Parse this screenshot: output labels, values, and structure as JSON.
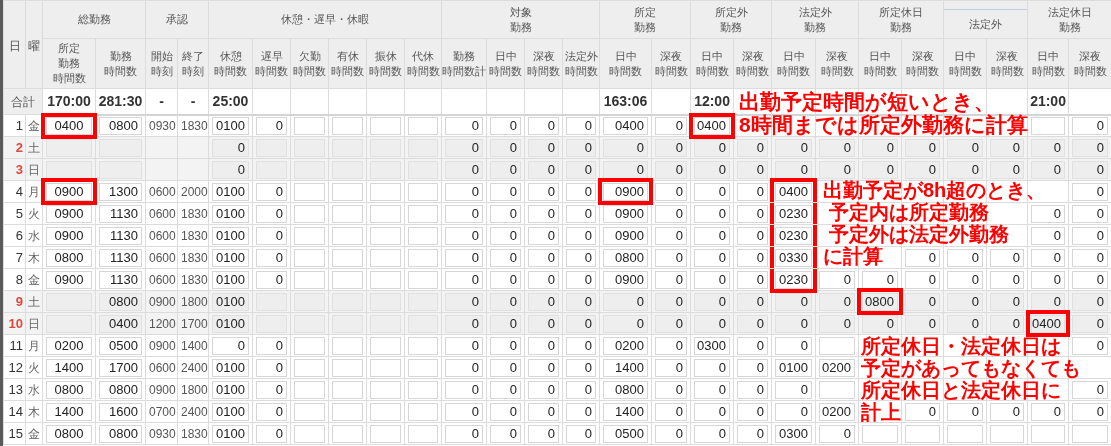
{
  "groups": [
    {
      "label": [
        "総勤務"
      ],
      "kind": "main",
      "columns": [
        {
          "label": [
            "所定",
            "勤務",
            "時間数"
          ],
          "kind": "field"
        },
        {
          "label": [
            "勤務",
            "時間数"
          ],
          "kind": "field"
        }
      ]
    },
    {
      "label": [
        "承認"
      ],
      "kind": "main",
      "columns": [
        {
          "label": [
            "開始",
            "時刻"
          ],
          "kind": "text"
        },
        {
          "label": [
            "終了",
            "時刻"
          ],
          "kind": "text"
        }
      ]
    },
    {
      "label": [
        "休憩・遅早・休暇"
      ],
      "kind": "main",
      "columns": [
        {
          "label": [
            "休憩",
            "時間数"
          ],
          "kind": "field"
        },
        {
          "label": [
            "遅早",
            "時間数"
          ],
          "kind": "field"
        },
        {
          "label": [
            "欠勤",
            "時間数"
          ],
          "kind": "field"
        },
        {
          "label": [
            "有休",
            "時間数"
          ],
          "kind": "field"
        },
        {
          "label": [
            "振休",
            "時間数"
          ],
          "kind": "field"
        },
        {
          "label": [
            "代休",
            "時間数"
          ],
          "kind": "field"
        }
      ]
    },
    {
      "label": [
        "対象",
        "勤務"
      ],
      "kind": "main",
      "columns": [
        {
          "label": [
            "勤務",
            "時間数計"
          ],
          "kind": "field"
        },
        {
          "label": [
            "日中",
            "時間数"
          ],
          "kind": "field"
        },
        {
          "label": [
            "深夜",
            "時間数"
          ],
          "kind": "field"
        },
        {
          "label": [
            "法定外",
            "時間数"
          ],
          "kind": "field"
        }
      ]
    },
    {
      "label": [
        "所定",
        "勤務"
      ],
      "kind": "main",
      "columns": [
        {
          "label": [
            "日中",
            "時間数"
          ],
          "kind": "field"
        },
        {
          "label": [
            "深夜",
            "時間数"
          ],
          "kind": "field"
        }
      ]
    },
    {
      "label": [
        "所定外",
        "勤務"
      ],
      "kind": "main",
      "columns": [
        {
          "label": [
            "日中",
            "時間数"
          ],
          "kind": "field"
        },
        {
          "label": [
            "深夜",
            "時間数"
          ],
          "kind": "field"
        }
      ]
    },
    {
      "label": [
        "法定外",
        "勤務"
      ],
      "kind": "main",
      "columns": [
        {
          "label": [
            "日中",
            "時間数"
          ],
          "kind": "field"
        },
        {
          "label": [
            "深夜",
            "時間数"
          ],
          "kind": "field"
        }
      ]
    },
    {
      "label": [
        "所定休日",
        "勤務"
      ],
      "kind": "main",
      "columns": [
        {
          "label": [
            "日中",
            "時間数"
          ],
          "kind": "field"
        },
        {
          "label": [
            "深夜",
            "時間数"
          ],
          "kind": "field"
        }
      ]
    },
    {
      "label": [
        "法定外"
      ],
      "kind": "sub",
      "columns": [
        {
          "label": [
            "日中",
            "時間数"
          ],
          "kind": "field"
        },
        {
          "label": [
            "深夜",
            "時間数"
          ],
          "kind": "field"
        }
      ]
    },
    {
      "label": [
        "法定休日",
        "勤務"
      ],
      "kind": "main",
      "columns": [
        {
          "label": [
            "日中",
            "時間数"
          ],
          "kind": "field"
        },
        {
          "label": [
            "深夜",
            "時間数"
          ],
          "kind": "field"
        }
      ]
    }
  ],
  "day_header": "日",
  "weekday_header": "曜",
  "total": {
    "label": "合計",
    "cells": [
      "170:00",
      "281:30",
      "-",
      "-",
      "25:00",
      null,
      null,
      null,
      null,
      null,
      null,
      null,
      null,
      null,
      "163:06",
      null,
      "12:00",
      null,
      null,
      null,
      null,
      null,
      null,
      null,
      "21:00",
      null
    ]
  },
  "rows": [
    {
      "day": "1",
      "weekday": "金",
      "holiday": false,
      "cells": [
        {
          "value": "0400",
          "highlighted": true
        },
        "0800",
        "0930",
        "1830",
        "0100",
        "0",
        null,
        null,
        null,
        null,
        "0",
        "0",
        "0",
        "0",
        "0400",
        "0",
        {
          "value": "0400",
          "highlighted": true
        },
        {
          "covered": true
        },
        {
          "covered": true
        },
        {
          "covered": true
        },
        {
          "covered": true
        },
        {
          "covered": true
        },
        {
          "covered": true
        },
        {
          "covered": true
        },
        null,
        "0"
      ]
    },
    {
      "day": "2",
      "weekday": "土",
      "holiday": true,
      "cells": [
        null,
        null,
        null,
        null,
        "0",
        null,
        null,
        null,
        null,
        null,
        "0",
        "0",
        "0",
        "0",
        "0",
        "0",
        "0",
        "0",
        "0",
        "0",
        "0",
        "0",
        "0",
        "0",
        "0",
        "0"
      ]
    },
    {
      "day": "3",
      "weekday": "日",
      "holiday": true,
      "cells": [
        null,
        null,
        null,
        null,
        "0",
        null,
        null,
        null,
        null,
        null,
        "0",
        "0",
        "0",
        "0",
        "0",
        "0",
        "0",
        "0",
        "0",
        "0",
        "0",
        "0",
        "0",
        "0",
        "0",
        "0"
      ]
    },
    {
      "day": "4",
      "weekday": "月",
      "holiday": false,
      "cells": [
        {
          "value": "0900",
          "highlighted": true
        },
        "1300",
        "0600",
        "2000",
        "0100",
        "0",
        null,
        null,
        null,
        null,
        "0",
        "0",
        "0",
        "0",
        {
          "value": "0900",
          "highlighted": true
        },
        "0",
        "0",
        "0",
        {
          "value": "0400",
          "highlighted": true
        },
        {
          "covered": true
        },
        {
          "covered": true
        },
        {
          "covered": true
        },
        {
          "covered": true
        },
        {
          "covered": true
        },
        {
          "covered": true
        },
        "0"
      ]
    },
    {
      "day": "5",
      "weekday": "火",
      "holiday": false,
      "cells": [
        "0900",
        "1130",
        "0600",
        "1830",
        "0100",
        "0",
        null,
        null,
        null,
        null,
        "0",
        "0",
        "0",
        "0",
        "0900",
        "0",
        "0",
        "0",
        {
          "value": "0230",
          "highlighted": true
        },
        {
          "covered": true
        },
        {
          "covered": true
        },
        {
          "covered": true
        },
        {
          "covered": true
        },
        {
          "covered": true
        },
        "0",
        "0"
      ]
    },
    {
      "day": "6",
      "weekday": "水",
      "holiday": false,
      "cells": [
        "0900",
        "1130",
        "0600",
        "1830",
        "0100",
        "0",
        null,
        null,
        null,
        null,
        "0",
        "0",
        "0",
        "0",
        "0900",
        "0",
        "0",
        "0",
        {
          "value": "0230",
          "highlighted": true
        },
        {
          "covered": true
        },
        {
          "covered": true
        },
        {
          "covered": true
        },
        {
          "covered": true
        },
        {
          "covered": true
        },
        "0",
        "0"
      ]
    },
    {
      "day": "7",
      "weekday": "木",
      "holiday": false,
      "cells": [
        "0800",
        "1130",
        "0600",
        "1830",
        "0100",
        "0",
        null,
        null,
        null,
        null,
        "0",
        "0",
        "0",
        "0",
        "0800",
        "0",
        "0",
        "0",
        {
          "value": "0330",
          "highlighted": true
        },
        {
          "covered": true
        },
        {
          "covered": true
        },
        "0",
        "0",
        "0",
        "0",
        "0"
      ]
    },
    {
      "day": "8",
      "weekday": "金",
      "holiday": false,
      "cells": [
        "0900",
        "1130",
        "0600",
        "1830",
        "0100",
        "0",
        null,
        null,
        null,
        null,
        "0",
        "0",
        "0",
        "0",
        "0900",
        "0",
        "0",
        "0",
        {
          "value": "0230",
          "highlighted": true
        },
        "0",
        "0",
        "0",
        "0",
        "0",
        "0",
        "0"
      ]
    },
    {
      "day": "9",
      "weekday": "土",
      "holiday": true,
      "cells": [
        null,
        "0800",
        "0900",
        "1800",
        "0100",
        null,
        null,
        null,
        null,
        null,
        "0",
        "0",
        "0",
        "0",
        "0",
        "0",
        "0",
        "0",
        "0",
        "0",
        {
          "value": "0800",
          "highlighted": true
        },
        "0",
        "0",
        "0",
        "0",
        "0"
      ]
    },
    {
      "day": "10",
      "weekday": "日",
      "holiday": true,
      "cells": [
        null,
        "0400",
        "1200",
        "1700",
        "0100",
        null,
        null,
        null,
        null,
        null,
        "0",
        "0",
        "0",
        "0",
        "0",
        "0",
        "0",
        "0",
        "0",
        "0",
        "0",
        "0",
        "0",
        "0",
        {
          "value": "0400",
          "highlighted": true
        },
        "0"
      ]
    },
    {
      "day": "11",
      "weekday": "月",
      "holiday": false,
      "cells": [
        "0200",
        "0500",
        "0900",
        "1400",
        "0",
        "0",
        null,
        null,
        null,
        null,
        "0",
        "0",
        "0",
        "0",
        "0200",
        "0",
        "0300",
        "0",
        "0",
        null,
        {
          "covered": true
        },
        {
          "covered": true
        },
        {
          "covered": true
        },
        {
          "covered": true
        },
        {
          "covered": true
        },
        "0"
      ]
    },
    {
      "day": "12",
      "weekday": "火",
      "holiday": false,
      "cells": [
        "1400",
        "1700",
        "0600",
        "2400",
        "0100",
        "0",
        null,
        null,
        null,
        null,
        "0",
        "0",
        "0",
        "0",
        "1400",
        "0",
        "0",
        "0",
        "0100",
        "0200",
        {
          "covered": true
        },
        {
          "covered": true
        },
        {
          "covered": true
        },
        {
          "covered": true
        },
        {
          "covered": true
        },
        {
          "covered": true
        }
      ]
    },
    {
      "day": "13",
      "weekday": "水",
      "holiday": false,
      "cells": [
        "0800",
        "0800",
        "0900",
        "1800",
        "0100",
        "0",
        null,
        null,
        null,
        null,
        "0",
        "0",
        "0",
        "0",
        "0800",
        "0",
        "0",
        "0",
        "0",
        null,
        {
          "covered": true
        },
        {
          "covered": true
        },
        {
          "covered": true
        },
        {
          "covered": true
        },
        {
          "covered": true
        },
        "0"
      ]
    },
    {
      "day": "14",
      "weekday": "木",
      "holiday": false,
      "cells": [
        "1400",
        "1600",
        "0700",
        "2400",
        "0100",
        "0",
        null,
        null,
        null,
        null,
        "0",
        "0",
        "0",
        "0",
        "1400",
        "0",
        "0",
        "0",
        "0",
        "0200",
        {
          "covered": true
        },
        "0",
        "0",
        "0",
        "0",
        "0"
      ]
    },
    {
      "day": "15",
      "weekday": "金",
      "holiday": false,
      "cells": [
        "0800",
        "0800",
        "0930",
        "1830",
        "0100",
        "0",
        null,
        null,
        null,
        null,
        "0",
        "0",
        "0",
        "0",
        "0500",
        "0",
        "0",
        "0",
        "0300",
        "0",
        null,
        null,
        null,
        null,
        null,
        null
      ]
    }
  ],
  "notes": [
    {
      "lines": [
        "出勤予定時間が短いとき、",
        "8時間までは所定外勤務に計算"
      ]
    },
    {
      "lines": [
        "出勤予定が8h超のとき、",
        " 予定内は所定勤務",
        " 予定外は法定外勤務",
        "に計算"
      ]
    },
    {
      "lines": [
        "所定休日・法定休日は",
        "予定があってもなくても",
        "所定休日と法定休日に",
        "計上"
      ]
    }
  ]
}
